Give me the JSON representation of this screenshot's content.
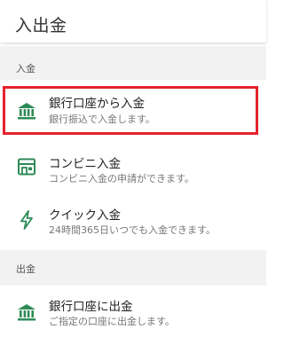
{
  "header": {
    "title": "入出金"
  },
  "colors": {
    "accent": "#2e8b57",
    "highlight": "#e3232d"
  },
  "deposit": {
    "section_label": "入金",
    "items": [
      {
        "icon": "bank-icon",
        "title": "銀行口座から入金",
        "subtitle": "銀行振込で入金します。"
      },
      {
        "icon": "convenience-store-icon",
        "title": "コンビニ入金",
        "subtitle": "コンビニ入金の申請ができます。"
      },
      {
        "icon": "lightning-icon",
        "title": "クイック入金",
        "subtitle": "24時間365日いつでも入金できます。"
      }
    ]
  },
  "withdraw": {
    "section_label": "出金",
    "items": [
      {
        "icon": "bank-icon",
        "title": "銀行口座に出金",
        "subtitle": "ご指定の口座に出金します。"
      }
    ]
  }
}
